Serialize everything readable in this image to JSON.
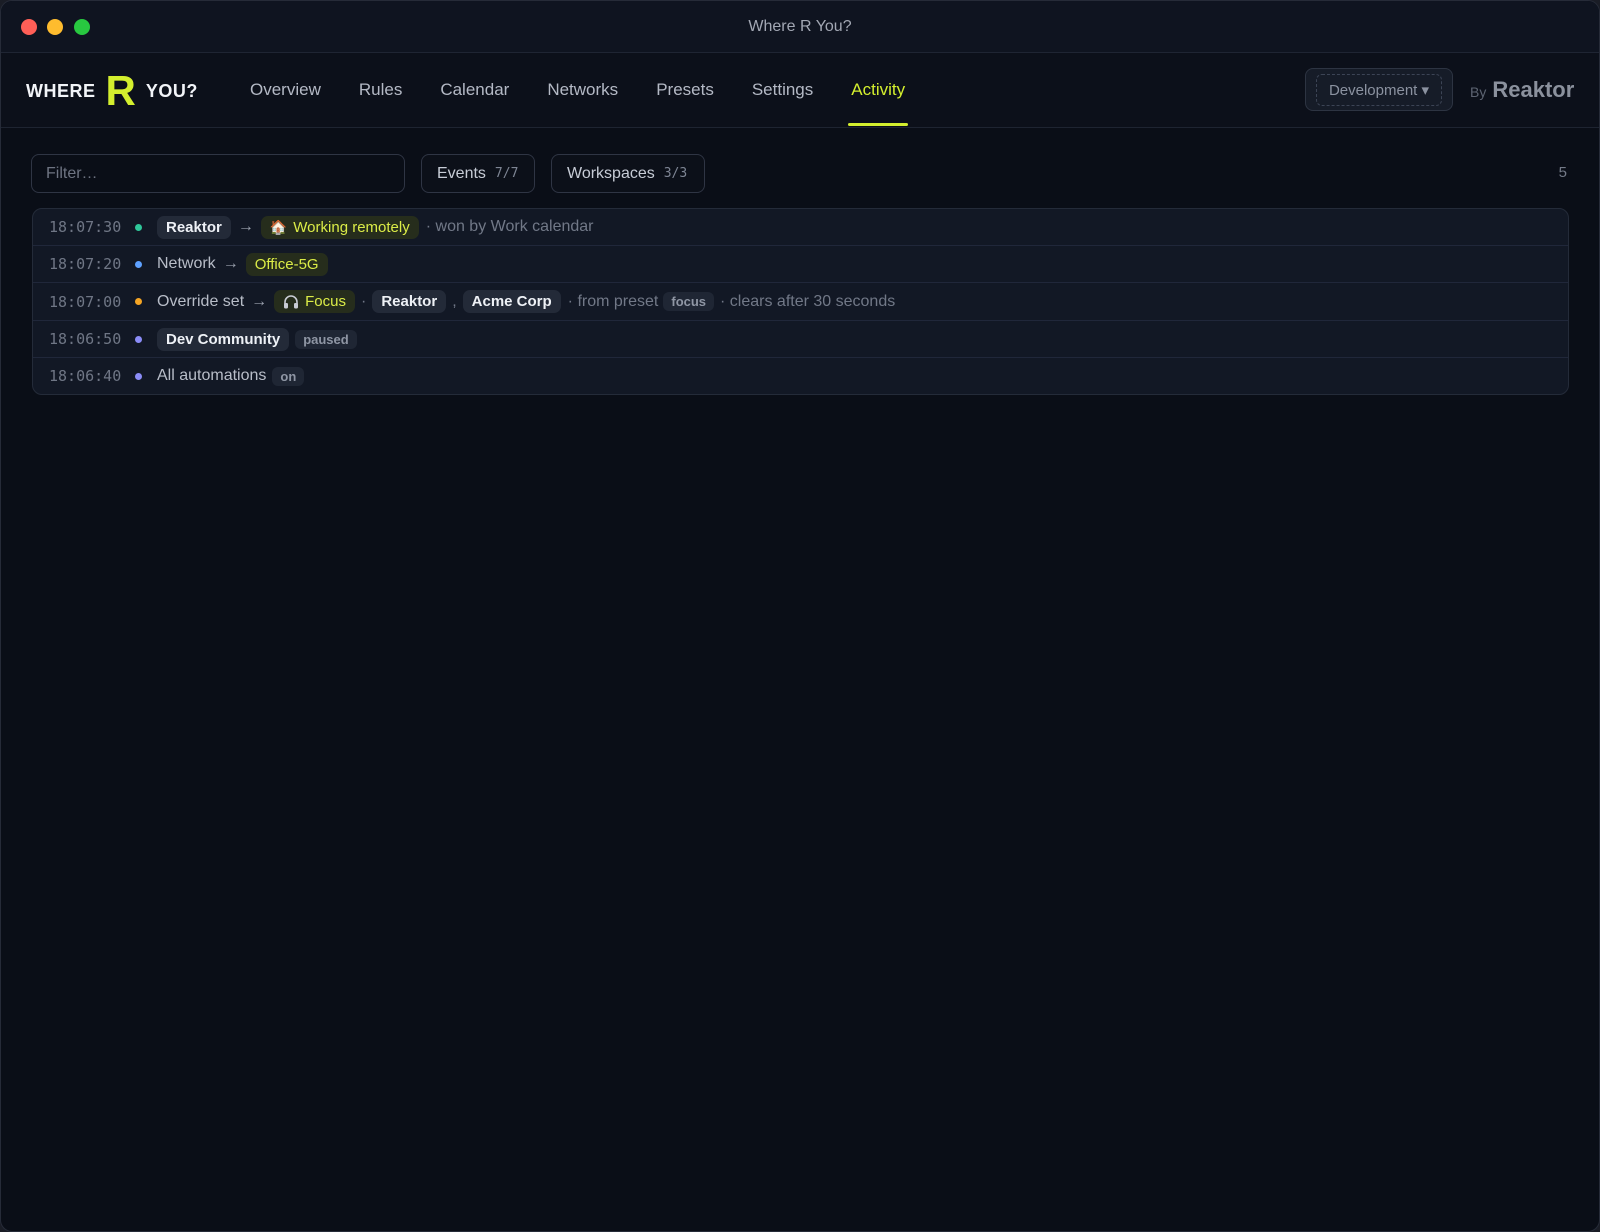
{
  "window": {
    "title": "Where R You?"
  },
  "brand": {
    "logo_left": "WHERE",
    "logo_mark": "R",
    "logo_right": "YOU?",
    "by_label": "By",
    "company": "Reaktor"
  },
  "nav": {
    "items": [
      {
        "label": "Overview"
      },
      {
        "label": "Rules"
      },
      {
        "label": "Calendar"
      },
      {
        "label": "Networks"
      },
      {
        "label": "Presets"
      },
      {
        "label": "Settings"
      },
      {
        "label": "Activity"
      }
    ],
    "active": "Activity"
  },
  "environment": {
    "label": "Development ▾"
  },
  "toolbar": {
    "filter_placeholder": "Filter…",
    "events_label": "Events",
    "events_count": "7/7",
    "workspaces_label": "Workspaces",
    "workspaces_count": "3/3",
    "total": "5"
  },
  "colors": {
    "accent": "#d4ef2e",
    "dot_green": "#2fc79a",
    "dot_blue": "#5ea1ff",
    "dot_orange": "#f5a524",
    "dot_violet": "#8b8cf7"
  },
  "activity": [
    {
      "time": "18:07:30",
      "workspace": "Reaktor",
      "arrow": "→",
      "status_icon": "house-icon",
      "status_emoji": "🏠",
      "status": "Working remotely",
      "source": "· won by Work calendar"
    },
    {
      "time": "18:07:20",
      "subject": "Network",
      "arrow": "→",
      "network": "Office-5G"
    },
    {
      "time": "18:07:00",
      "subject": "Override set",
      "arrow": "→",
      "status_icon": "headphones-icon",
      "status": "Focus",
      "dot_sep": "·",
      "workspace_a": "Reaktor",
      "comma": ",",
      "workspace_b": "Acme Corp",
      "preset_prefix": "· from preset",
      "preset": "focus",
      "clears": "· clears after 30 seconds"
    },
    {
      "time": "18:06:50",
      "workspace": "Dev Community",
      "state": "paused"
    },
    {
      "time": "18:06:40",
      "subject": "All automations",
      "state": "on"
    }
  ]
}
